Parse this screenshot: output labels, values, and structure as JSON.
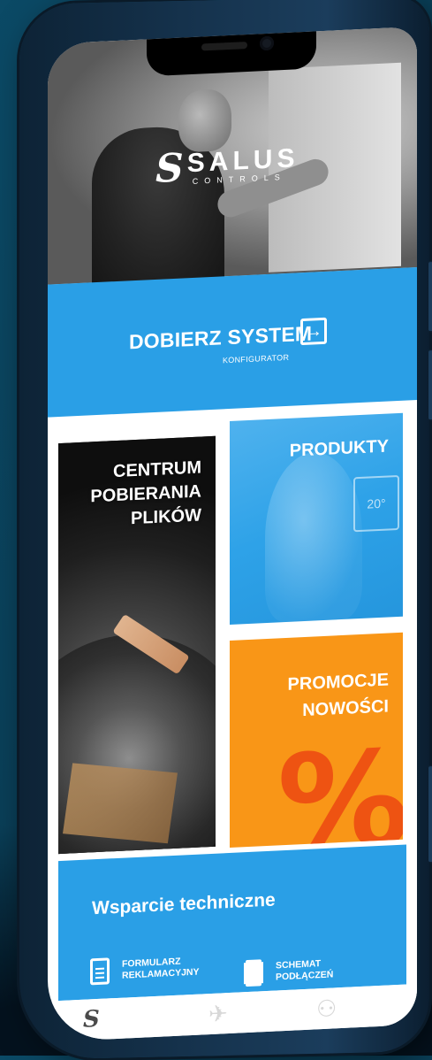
{
  "brand": {
    "logo_main": "SALUS",
    "logo_sub": "CONTROLS",
    "logo_mark": "S"
  },
  "configurator": {
    "title": "DOBIERZ SYSTEM",
    "subtitle": "KONFIGURATOR",
    "icon": "arrow-right-box-icon"
  },
  "tiles": {
    "files": {
      "line1": "CENTRUM",
      "line2": "POBIERANIA",
      "line3": "PLIKÓW"
    },
    "products": {
      "title": "PRODUKTY"
    },
    "promo": {
      "line1": "PROMOCJE",
      "line2": "NOWOŚCI",
      "symbol": "%"
    }
  },
  "support": {
    "title": "Wsparcie techniczne",
    "items": [
      {
        "line1": "FORMULARZ",
        "line2": "REKLAMACYJNY",
        "icon": "document-icon"
      },
      {
        "line1": "SCHEMAT",
        "line2": "PODŁĄCZEŃ",
        "icon": "chip-icon"
      }
    ]
  },
  "nav": {
    "home": "S",
    "plane": "✈",
    "user": "⚇"
  },
  "colors": {
    "accent_blue": "#2a9fe6",
    "promo_orange": "#f99617",
    "percent_red": "#ee5312"
  }
}
